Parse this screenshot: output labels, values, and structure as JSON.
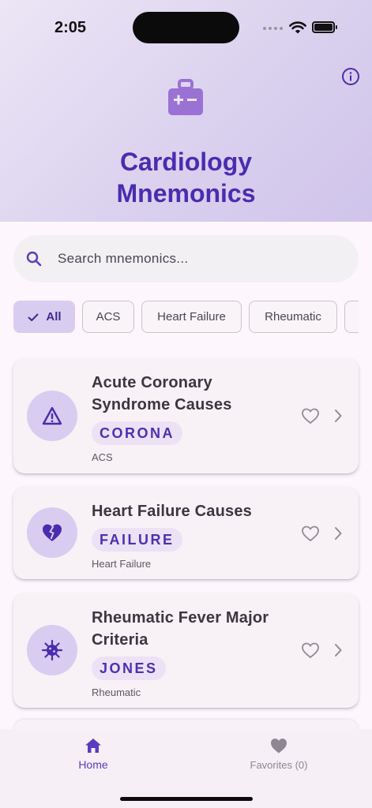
{
  "status_bar": {
    "time": "2:05"
  },
  "header": {
    "title_line1": "Cardiology",
    "title_line2": "Mnemonics"
  },
  "search": {
    "placeholder": "Search mnemonics...",
    "value": ""
  },
  "filters": [
    {
      "label": "All",
      "selected": true
    },
    {
      "label": "ACS",
      "selected": false
    },
    {
      "label": "Heart Failure",
      "selected": false
    },
    {
      "label": "Rheumatic",
      "selected": false
    }
  ],
  "cards": [
    {
      "title": "Acute Coronary Syndrome Causes",
      "mnemonic": "CORONA",
      "category": "ACS",
      "icon": "warning-icon",
      "favorite": false
    },
    {
      "title": "Heart Failure Causes",
      "mnemonic": "FAILURE",
      "category": "Heart Failure",
      "icon": "broken-heart-icon",
      "favorite": false
    },
    {
      "title": "Rheumatic Fever Major Criteria",
      "mnemonic": "JONES",
      "category": "Rheumatic",
      "icon": "virus-icon",
      "favorite": false
    }
  ],
  "bottom_nav": {
    "home_label": "Home",
    "favorites_label": "Favorites (0)"
  },
  "colors": {
    "primary": "#5a3cc0",
    "title": "#4a2cb0",
    "avatar_bg": "#d8cdf0",
    "card_bg": "#f8f2f7"
  }
}
